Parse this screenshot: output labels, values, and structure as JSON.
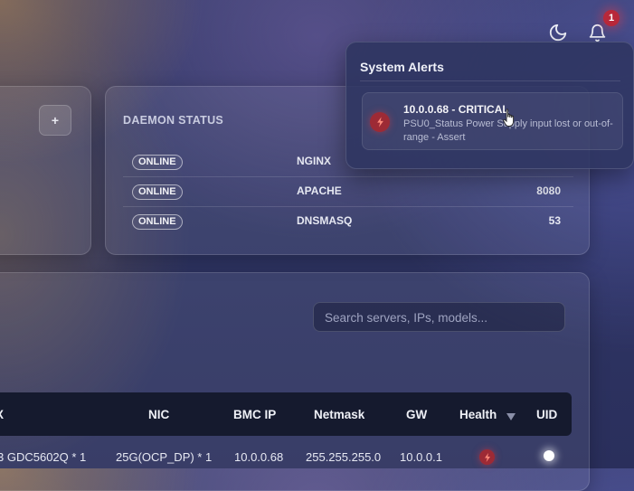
{
  "header": {
    "theme_icon": "moon-icon",
    "notification_icon": "bell-icon",
    "notification_count": "1"
  },
  "left_card": {
    "add_label": "+"
  },
  "daemon_status": {
    "title": "DAEMON STATUS",
    "rows": [
      {
        "status": "ONLINE",
        "name": "NGINX",
        "port": ""
      },
      {
        "status": "ONLINE",
        "name": "APACHE",
        "port": "8080"
      },
      {
        "status": "ONLINE",
        "name": "DNSMASQ",
        "port": "53"
      }
    ]
  },
  "search": {
    "placeholder": "Search servers, IPs, models..."
  },
  "table": {
    "columns": {
      "partial": "X",
      "nic": "NIC",
      "bmc_ip": "BMC IP",
      "netmask": "Netmask",
      "gw": "GW",
      "health": "Health",
      "uid": "UID"
    },
    "sort_icon": "triangle-down-icon",
    "rows": [
      {
        "model": "3 GDC5602Q * 1",
        "nic": "25G(OCP_DP) * 1",
        "bmc_ip": "10.0.0.68",
        "netmask": "255.255.255.0",
        "gw": "10.0.0.1",
        "health_icon": "lightning-icon",
        "uid_icon": "uid-light-icon"
      }
    ]
  },
  "alerts": {
    "title": "System Alerts",
    "items": [
      {
        "icon": "lightning-icon",
        "heading": "10.0.0.68 - CRITICAL",
        "message": "PSU0_Status Power Supply input lost or out-of-range - Assert"
      }
    ]
  },
  "colors": {
    "critical": "#9d2a35",
    "badge": "#b8283a",
    "table_header": "#151a2e"
  }
}
